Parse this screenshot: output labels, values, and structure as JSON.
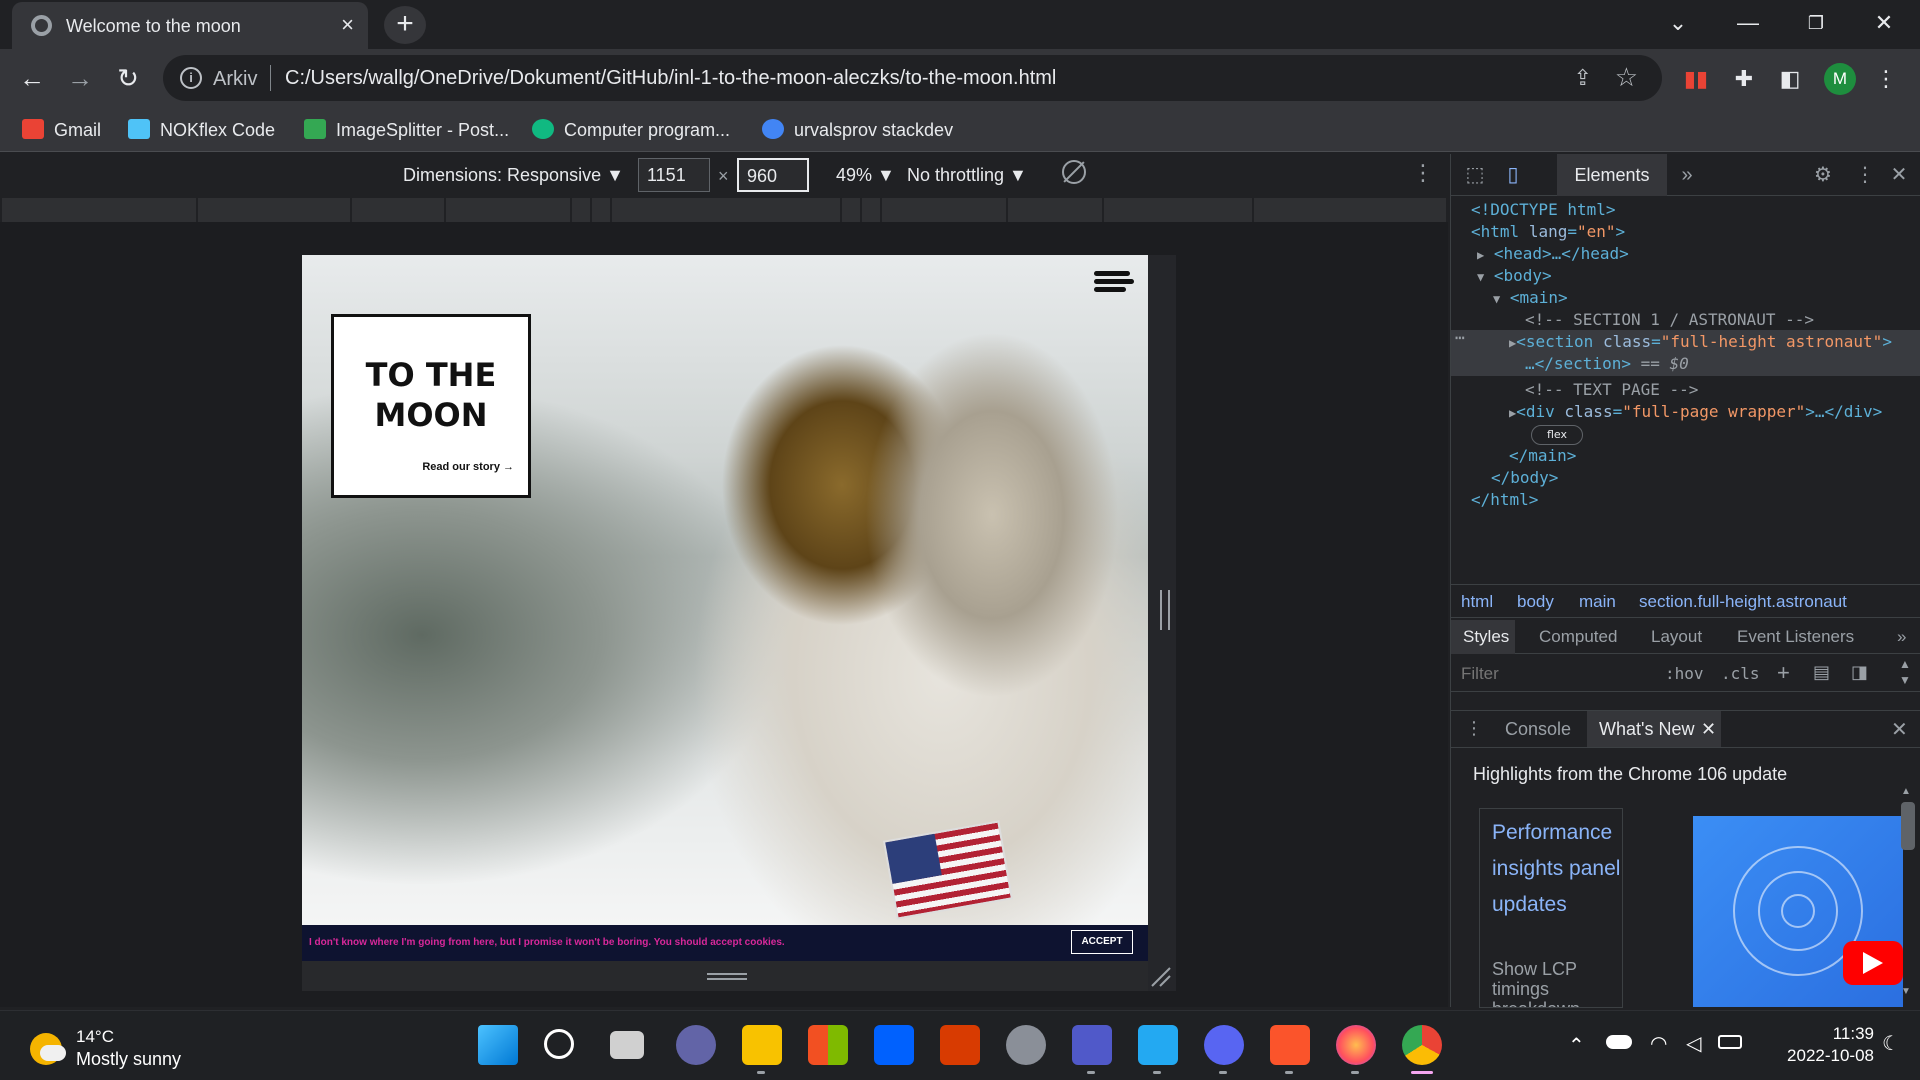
{
  "tab": {
    "title": "Welcome to the moon",
    "close": "×",
    "new_tab": "+"
  },
  "window": {
    "minimize": "—",
    "restore": "❐",
    "close": "✕",
    "tab_search": "⌄"
  },
  "toolbar": {
    "back": "←",
    "forward": "→",
    "reload": "↻",
    "url_prefix": "Arkiv",
    "url": "C:/Users/wallg/OneDrive/Dokument/GitHub/inl-1-to-the-moon-aleczks/to-the-moon.html",
    "avatar_letter": "M"
  },
  "bookmarks": [
    {
      "label": "Gmail",
      "color": "#ea4335"
    },
    {
      "label": "NOKflex Code",
      "color": "#4fc3f7"
    },
    {
      "label": "ImageSplitter - Post...",
      "color": "#34a853"
    },
    {
      "label": "Computer program...",
      "color": "#10b981"
    },
    {
      "label": "urvalsprov stackdev",
      "color": "#4285f4"
    }
  ],
  "device_toolbar": {
    "dimensions": "Dimensions: Responsive ▼",
    "width": "1151",
    "times": "×",
    "height": "960",
    "zoom": "49% ▼",
    "throttling": "No throttling ▼"
  },
  "page": {
    "heading_line1": "TO THE",
    "heading_line2": "MOON",
    "read_link": "Read our story →",
    "cookie_message": "I don't know where I'm going from here, but I promise it won't be boring. You should accept cookies.",
    "accept_button": "ACCEPT"
  },
  "devtools": {
    "elements_tab": "Elements",
    "more_tabs": "»",
    "dom": {
      "doctype": "<!DOCTYPE html>",
      "html_open_tag": "<html",
      "html_attr": "lang",
      "html_attr_val": "\"en\"",
      "head": "<head>…</head>",
      "body_open": "<body>",
      "main_open": "<main>",
      "comment1": "<!-- SECTION 1 / ASTRONAUT -->",
      "section_tag": "<section",
      "section_attr": "class",
      "section_val": "\"full-height astronaut\"",
      "section_close": "…</section>",
      "selected_marker": "== $0",
      "comment2": "<!-- TEXT PAGE -->",
      "div_tag": "<div",
      "div_attr": "class",
      "div_val": "\"full-page wrapper\"",
      "div_close": ">…</div>",
      "flex_badge": "flex",
      "main_close": "</main>",
      "body_close": "</body>",
      "html_close": "</html>"
    },
    "breadcrumbs": [
      "html",
      "body",
      "main",
      "section.full-height.astronaut"
    ],
    "style_tabs": [
      "Styles",
      "Computed",
      "Layout",
      "Event Listeners"
    ],
    "filter_placeholder": "Filter",
    "hov": ":hov",
    "cls": ".cls",
    "drawer_tabs": {
      "console": "Console",
      "whats_new": "What's New"
    },
    "whats_new": {
      "highlight": "Highlights from the Chrome 106 update",
      "card_title": "Performance insights panel updates",
      "card_sub": "Show LCP timings breakdown"
    }
  },
  "taskbar": {
    "temperature": "14°C",
    "condition": "Mostly sunny",
    "time": "11:39",
    "date": "2022-10-08"
  },
  "colors": {
    "chrome_dark": "#202124",
    "chrome_toolbar": "#35363a",
    "accent_link": "#8ab4f8",
    "cookie_text": "#d8289a",
    "cookie_bg": "#0e1330"
  }
}
